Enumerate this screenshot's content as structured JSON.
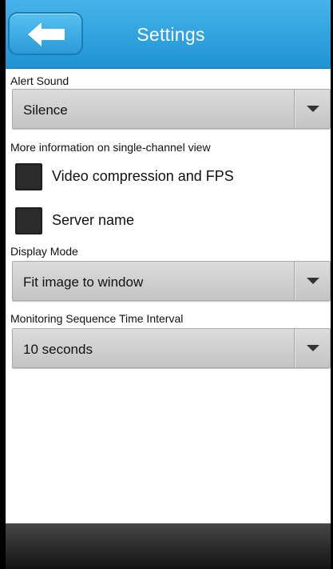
{
  "header": {
    "title": "Settings",
    "back_icon": "arrow-left-icon",
    "accent": "#2ba3df"
  },
  "alert_sound": {
    "label": "Alert Sound",
    "selected": "Silence"
  },
  "more_info": {
    "label": "More information on single-channel view",
    "options": [
      {
        "label": "Video compression and FPS",
        "checked": false
      },
      {
        "label": "Server name",
        "checked": false
      }
    ]
  },
  "display_mode": {
    "label": "Display Mode",
    "selected": "Fit image to window"
  },
  "monitoring_interval": {
    "label": "Monitoring Sequence Time Interval",
    "selected": "10 seconds"
  }
}
